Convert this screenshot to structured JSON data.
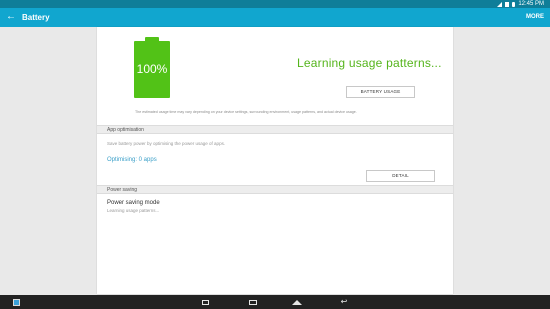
{
  "status_bar": {
    "time": "12:45 PM"
  },
  "app_bar": {
    "title": "Battery",
    "more_label": "MORE",
    "back_icon": "arrow-left-icon"
  },
  "battery": {
    "level_text": "100%",
    "status_text": "Learning usage patterns...",
    "usage_button_label": "BATTERY USAGE",
    "disclaimer": "The estimated usage time may vary depending on your device settings, surrounding environment, usage patterns, and actual device usage.",
    "color": "#52c217"
  },
  "app_optimisation": {
    "header": "App optimisation",
    "description": "Save battery power by optimising the power usage of apps.",
    "optimising_text": "Optimising: 0 apps",
    "detail_button_label": "DETAIL"
  },
  "power_saving": {
    "header": "Power saving",
    "mode_title": "Power saving mode",
    "mode_subtitle": "Learning usage patterns..."
  },
  "nav_bar": {
    "icons": [
      "app-launcher-icon",
      "recent-apps-icon",
      "keyboard-icon",
      "home-icon",
      "back-icon"
    ]
  }
}
